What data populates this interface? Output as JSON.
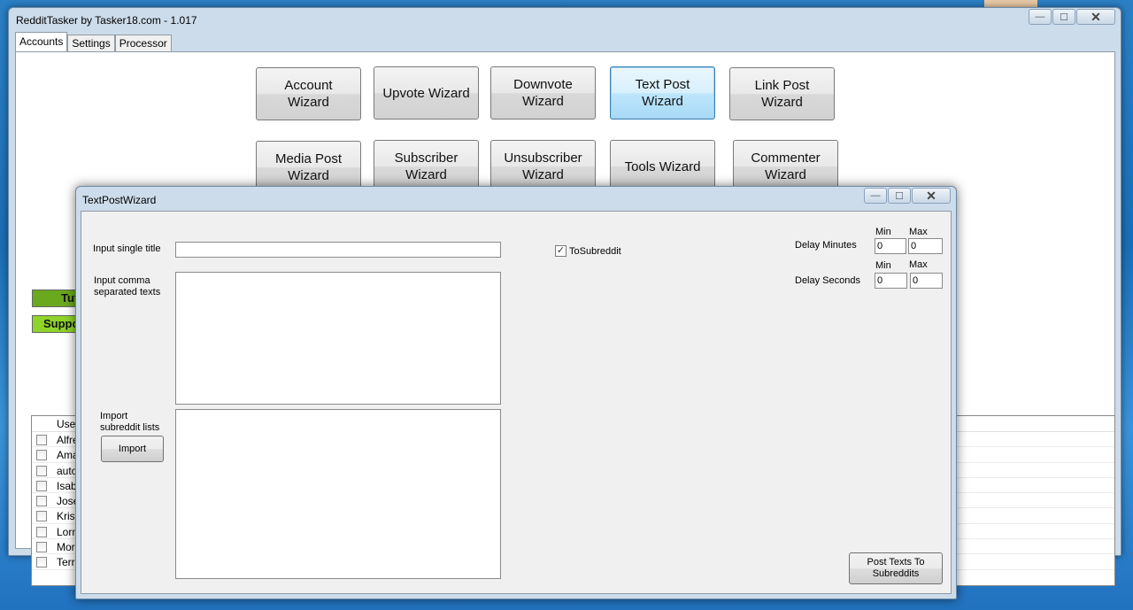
{
  "app": {
    "title": "RedditTasker by Tasker18.com - 1.017",
    "tabs": [
      "Accounts",
      "Settings",
      "Processor"
    ]
  },
  "wizards": {
    "row1": [
      "Account Wizard",
      "Upvote Wizard",
      "Downvote Wizard",
      "Text Post Wizard",
      "Link Post Wizard"
    ],
    "row2": [
      "Media Post Wizard",
      "Subscriber Wizard",
      "Unsubscriber Wizard",
      "Tools Wizard",
      "Commenter Wizard"
    ]
  },
  "side_buttons": {
    "tutorial": "Tuto",
    "support": "Suppor"
  },
  "accounts_list": {
    "header": "User...",
    "rows": [
      "Alfre...",
      "Ama...",
      "auto...",
      "Isabe...",
      "Jose...",
      "Kristi...",
      "Lorn...",
      "Morr...",
      "Terri..."
    ]
  },
  "dialog": {
    "title": "TextPostWizard",
    "single_title_label": "Input single title",
    "single_title_value": "",
    "comma_texts_label": "Input comma separated texts",
    "import_label": "Import subreddit lists",
    "import_button": "Import",
    "to_subreddit_label": "ToSubreddit",
    "to_subreddit_checked": true,
    "delay_minutes_label": "Delay Minutes",
    "delay_seconds_label": "Delay Seconds",
    "min_label": "Min",
    "max_label": "Max",
    "delay_minutes_min": "0",
    "delay_minutes_max": "0",
    "delay_seconds_min": "0",
    "delay_seconds_max": "0",
    "post_button": "Post Texts To Subreddits"
  },
  "window_controls": {
    "minimize": "—",
    "maximize": "☐",
    "close": "✕"
  }
}
